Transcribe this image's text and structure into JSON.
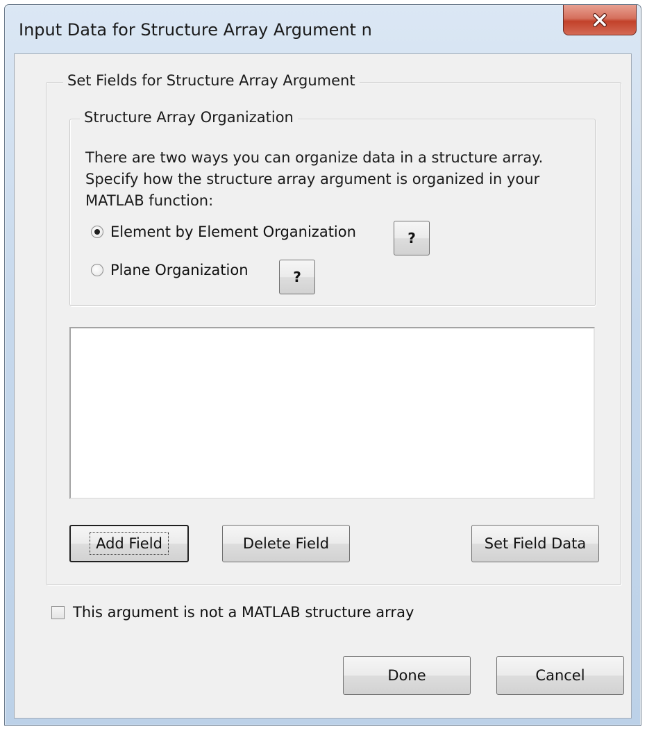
{
  "window": {
    "title": "Input Data for Structure Array Argument n",
    "close_icon": "close-x-icon"
  },
  "fields_group": {
    "legend": "Set Fields for Structure Array Argument"
  },
  "organization_group": {
    "legend": "Structure Array Organization",
    "description": "There are two ways you can organize data in a structure array. Specify how the structure array argument is organized in your MATLAB function:",
    "options": [
      {
        "label": "Element by Element Organization",
        "checked": true,
        "help_label": "?"
      },
      {
        "label": "Plane Organization",
        "checked": false,
        "help_label": "?"
      }
    ]
  },
  "field_list": {
    "items": []
  },
  "buttons": {
    "add_field": "Add Field",
    "delete_field": "Delete Field",
    "set_field_data": "Set Field Data",
    "done": "Done",
    "cancel": "Cancel"
  },
  "not_structure_checkbox": {
    "label": "This argument is not a MATLAB structure array",
    "checked": false
  }
}
